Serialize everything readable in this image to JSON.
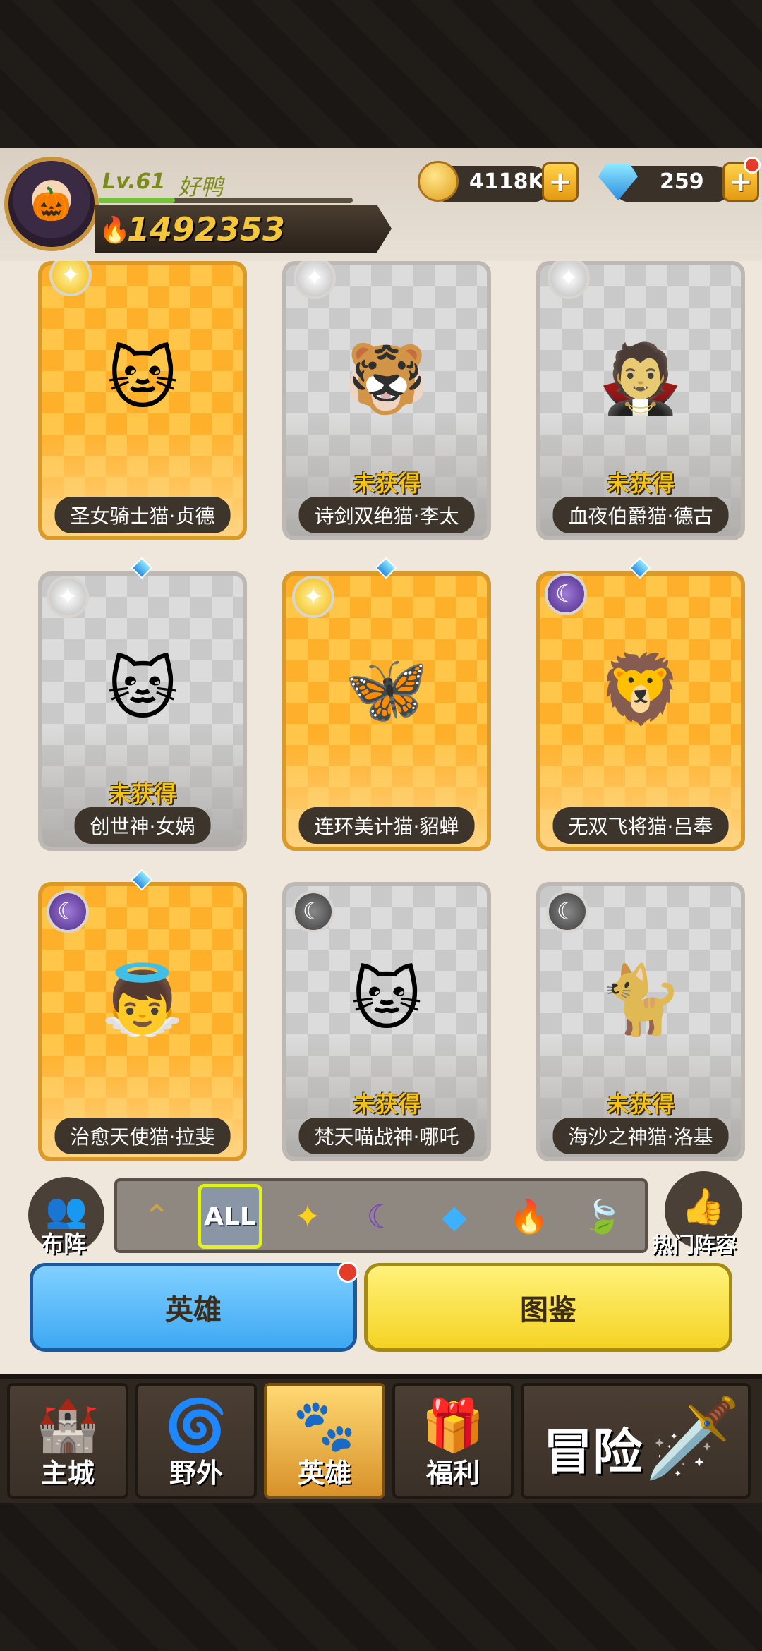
{
  "player": {
    "level": "Lv.61",
    "name": "好鸭",
    "power": "1492353",
    "level_progress": 0.3
  },
  "resources": {
    "coins": "4118K",
    "gems": "259",
    "plus": "+"
  },
  "heroes": [
    {
      "name": "圣女骑士猫·贞德",
      "status": "",
      "element": "light",
      "emoji": "🐱"
    },
    {
      "name": "诗剑双绝猫·李太",
      "status": "未获得",
      "element": "light",
      "emoji": "🐯"
    },
    {
      "name": "血夜伯爵猫·德古",
      "status": "未获得",
      "element": "light",
      "emoji": "🧛"
    },
    {
      "name": "创世神·女娲",
      "status": "未获得",
      "element": "light",
      "emoji": "🐱"
    },
    {
      "name": "连环美计猫·貂蝉",
      "status": "",
      "element": "light",
      "emoji": "🦋"
    },
    {
      "name": "无双飞将猫·吕奉",
      "status": "",
      "element": "dark",
      "emoji": "🦁"
    },
    {
      "name": "治愈天使猫·拉斐",
      "status": "",
      "element": "dark",
      "emoji": "👼"
    },
    {
      "name": "梵天喵战神·哪吒",
      "status": "未获得",
      "element": "dark",
      "emoji": "🐱"
    },
    {
      "name": "海沙之神猫·洛基",
      "status": "未获得",
      "element": "dark",
      "emoji": "🐈"
    }
  ],
  "filters": {
    "formation_label": "布阵",
    "all_label": "ALL",
    "popular_label": "热门阵容",
    "elements": [
      "arrow-up-icon",
      "all",
      "light-icon",
      "dark-icon",
      "water-icon",
      "fire-icon",
      "wind-icon"
    ]
  },
  "tabs": {
    "heroes": "英雄",
    "codex": "图鉴"
  },
  "nav": {
    "main_city": "主城",
    "wild": "野外",
    "heroes": "英雄",
    "welfare": "福利",
    "adventure": "冒险"
  }
}
